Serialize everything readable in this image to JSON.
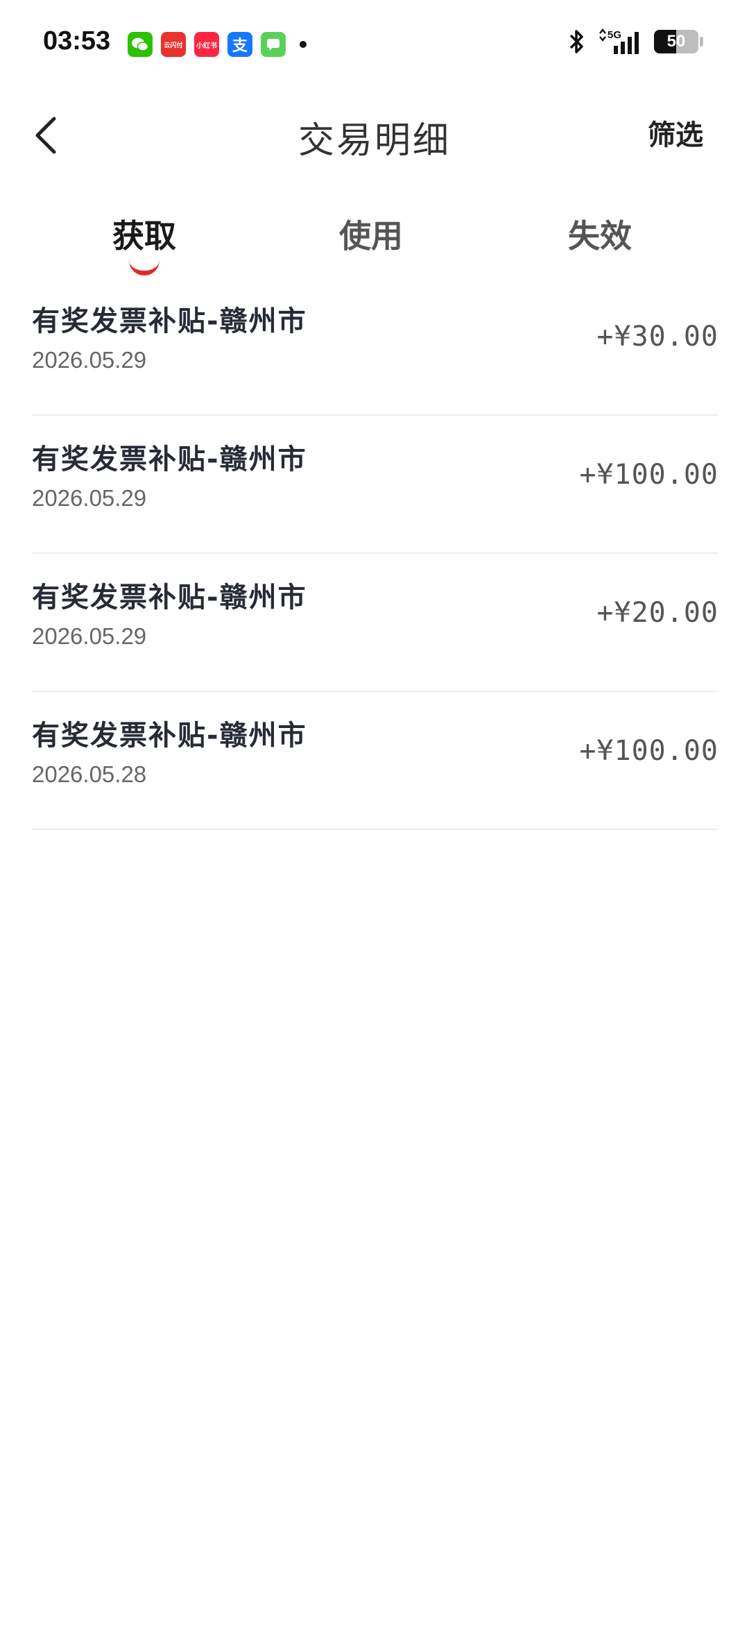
{
  "status_bar": {
    "time": "03:53",
    "notifications": [
      {
        "name": "wechat",
        "label": "",
        "color": "#2dc100"
      },
      {
        "name": "yunshanfu",
        "label": "云闪付",
        "color": "#e8322b"
      },
      {
        "name": "xiaohongshu",
        "label": "小红书",
        "color": "#ff2442"
      },
      {
        "name": "alipay",
        "label": "支",
        "color": "#1677ff"
      },
      {
        "name": "messages",
        "label": "",
        "color": "#5ad05a"
      }
    ],
    "network": "5G",
    "battery_level": "50",
    "battery_fraction": 0.5
  },
  "header": {
    "title": "交易明细",
    "filter_label": "筛选",
    "back_icon": "chevron-left-icon"
  },
  "tabs": [
    {
      "label": "获取",
      "active": true
    },
    {
      "label": "使用",
      "active": false
    },
    {
      "label": "失效",
      "active": false
    }
  ],
  "accent_color": "#e4282a",
  "transactions": [
    {
      "title": "有奖发票补贴-赣州市",
      "date": "2026.05.29",
      "amount": "+¥30.00"
    },
    {
      "title": "有奖发票补贴-赣州市",
      "date": "2026.05.29",
      "amount": "+¥100.00"
    },
    {
      "title": "有奖发票补贴-赣州市",
      "date": "2026.05.29",
      "amount": "+¥20.00"
    },
    {
      "title": "有奖发票补贴-赣州市",
      "date": "2026.05.28",
      "amount": "+¥100.00"
    }
  ]
}
